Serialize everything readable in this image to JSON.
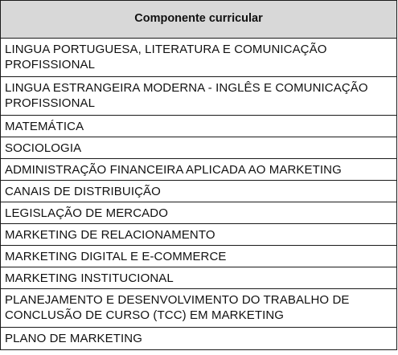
{
  "table": {
    "header": "Componente curricular",
    "rows": [
      "LINGUA PORTUGUESA, LITERATURA E COMUNICAÇÃO PROFISSIONAL",
      "LINGUA ESTRANGEIRA MODERNA - INGLÊS E COMUNICAÇÃO PROFISSIONAL",
      "MATEMÁTICA",
      "SOCIOLOGIA",
      "ADMINISTRAÇÃO FINANCEIRA APLICADA AO MARKETING",
      "CANAIS DE DISTRIBUIÇÃO",
      "LEGISLAÇÃO DE MERCADO",
      "MARKETING DE RELACIONAMENTO",
      "MARKETING DIGITAL E E-COMMERCE",
      "MARKETING INSTITUCIONAL",
      "PLANEJAMENTO E DESENVOLVIMENTO DO TRABALHO DE CONCLUSÃO DE CURSO (TCC) EM MARKETING",
      "PLANO DE MARKETING"
    ]
  }
}
